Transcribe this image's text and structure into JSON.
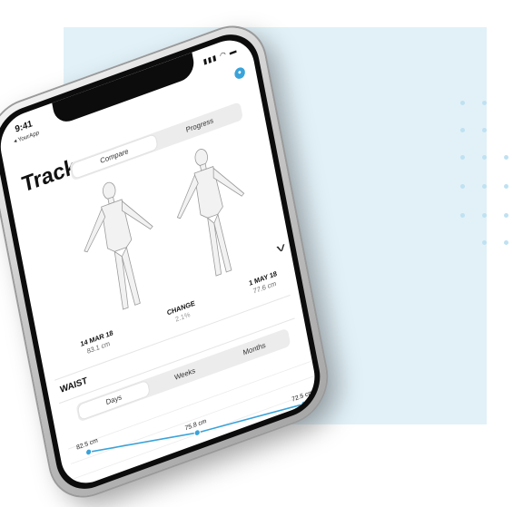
{
  "status": {
    "time": "9:41",
    "back_label": "◂ YourApp",
    "signal_icon": "signal-wifi-battery-icons"
  },
  "header": {
    "title": "Track",
    "avatar_icon": "profile-avatar-icon"
  },
  "view_tabs": [
    {
      "label": "Compare",
      "active": true
    },
    {
      "label": "Progress",
      "active": false
    }
  ],
  "comparison": {
    "before": {
      "date": "14 MAR 18",
      "value": "83.1 cm"
    },
    "change": {
      "label": "CHANGE",
      "value": "2.1%"
    },
    "after": {
      "date": "1 MAY 18",
      "value": "77.6 cm"
    }
  },
  "metric": {
    "name": "WAIST"
  },
  "range_tabs": [
    {
      "label": "Days",
      "active": true
    },
    {
      "label": "Weeks",
      "active": false
    },
    {
      "label": "Months",
      "active": false
    }
  ],
  "chart_data": {
    "type": "line",
    "x": [
      1,
      2,
      3
    ],
    "values": [
      82.5,
      75.8,
      72.5
    ],
    "point_labels": [
      "82.5 cm",
      "75.8 cm",
      "72.5 cm"
    ],
    "ylim": [
      70,
      86
    ],
    "grid": true,
    "color": "#3aa3d9"
  },
  "colors": {
    "accent": "#3aa3d9",
    "background_panel": "#e2f1f8"
  }
}
